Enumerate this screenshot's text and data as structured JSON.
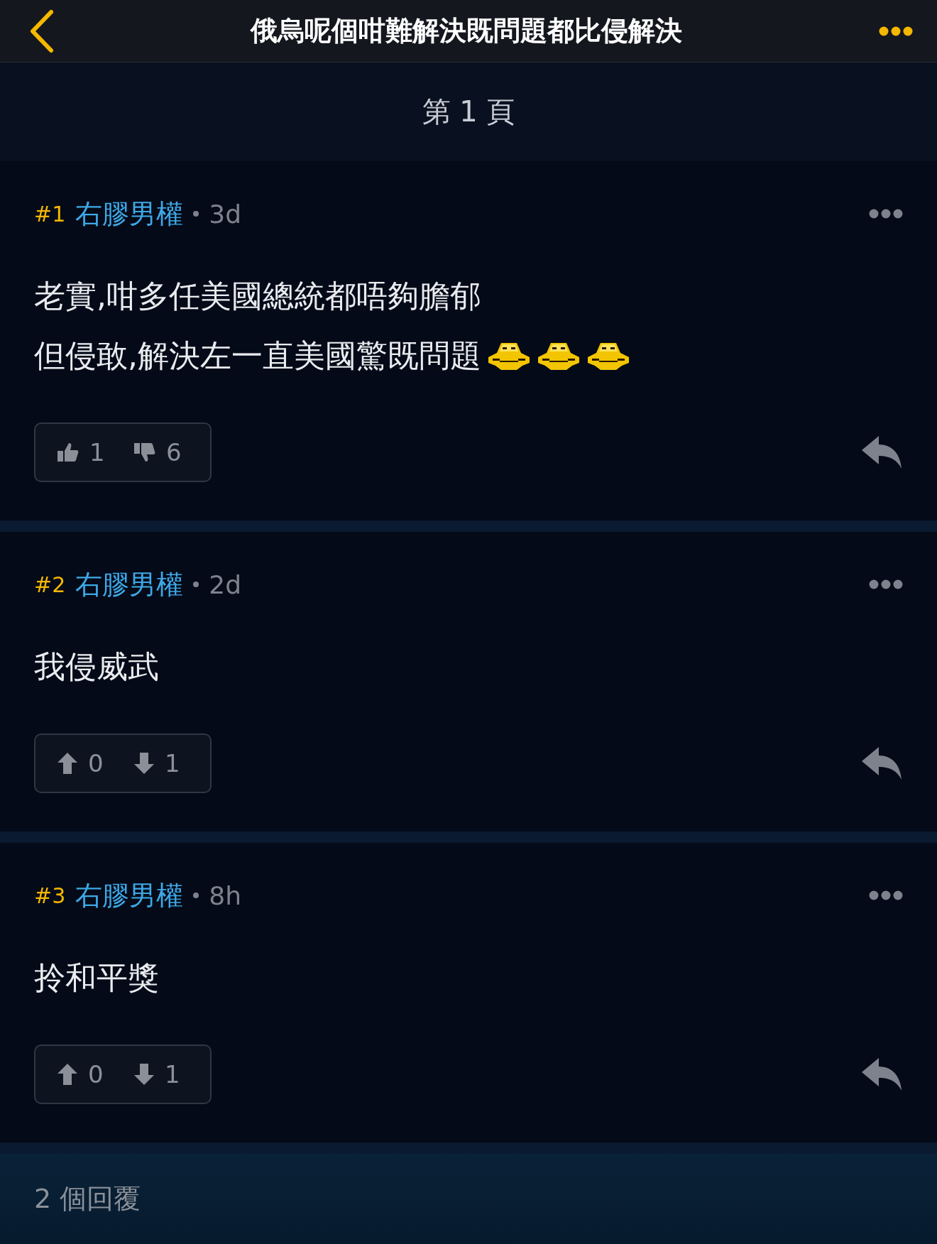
{
  "header": {
    "title": "俄烏呢個咁難解決既問題都比侵解決"
  },
  "page_label": "第 1 頁",
  "posts": [
    {
      "number": "#1",
      "author": "右膠男權",
      "time": "3d",
      "lines": [
        {
          "text": "老實,咁多任美國總統都唔夠膽郁"
        },
        {
          "text": "但侵敢,解決左一直美國驚既問題",
          "emojis": [
            {
              "kind": "ufo"
            },
            {
              "kind": "ufo"
            },
            {
              "kind": "ufo"
            }
          ]
        }
      ],
      "votes": {
        "kind": "thumb",
        "up": "1",
        "down": "6"
      }
    },
    {
      "number": "#2",
      "author": "右膠男權",
      "time": "2d",
      "lines": [
        {
          "text": "我侵威武"
        }
      ],
      "votes": {
        "kind": "arrow",
        "up": "0",
        "down": "1"
      }
    },
    {
      "number": "#3",
      "author": "右膠男權",
      "time": "8h",
      "lines": [
        {
          "text": "拎和平獎"
        }
      ],
      "votes": {
        "kind": "arrow",
        "up": "0",
        "down": "1"
      }
    }
  ],
  "footer": "2 個回覆"
}
